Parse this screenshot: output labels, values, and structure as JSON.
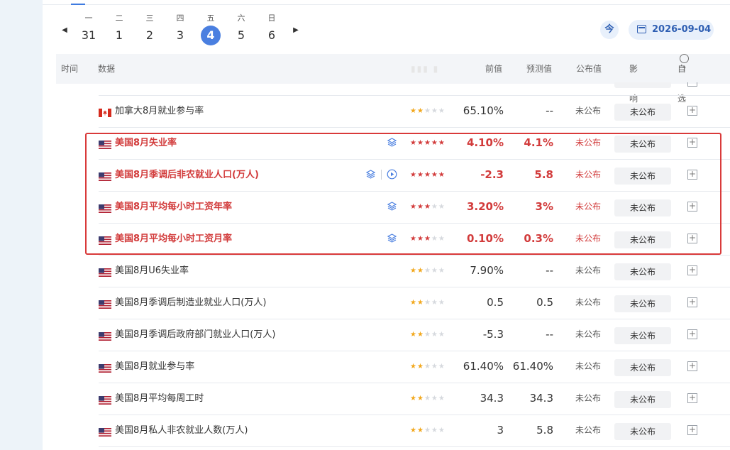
{
  "calendar": {
    "prev_arrow": "◀",
    "next_arrow": "▶",
    "days": [
      {
        "weekday": "一",
        "date": "31"
      },
      {
        "weekday": "二",
        "date": "1"
      },
      {
        "weekday": "三",
        "date": "2"
      },
      {
        "weekday": "四",
        "date": "3"
      },
      {
        "weekday": "五",
        "date": "4",
        "selected": true
      },
      {
        "weekday": "六",
        "date": "5"
      },
      {
        "weekday": "日",
        "date": "6"
      }
    ],
    "today_button": "今",
    "selected_date": "2026-09-04"
  },
  "table": {
    "headers": {
      "time": "时间",
      "data": "数据",
      "previous": "前值",
      "forecast": "预测值",
      "actual": "公布值",
      "impact": "影响",
      "watchlist": "自选"
    },
    "rows": [
      {
        "country": "CA",
        "name": "加拿大8月就业参与率",
        "stars": 2,
        "previous": "65.10%",
        "forecast": "--",
        "actual": "未公布",
        "impact": "未公布",
        "highlight": false
      },
      {
        "country": "US",
        "name": "美国8月失业率",
        "stars": 5,
        "previous": "4.10%",
        "forecast": "4.1%",
        "actual": "未公布",
        "impact": "未公布",
        "highlight": true,
        "icons": [
          "layers-icon"
        ]
      },
      {
        "country": "US",
        "name": "美国8月季调后非农就业人口(万人)",
        "stars": 5,
        "previous": "-2.3",
        "forecast": "5.8",
        "actual": "未公布",
        "impact": "未公布",
        "highlight": true,
        "icons": [
          "layers-icon",
          "play-icon"
        ]
      },
      {
        "country": "US",
        "name": "美国8月平均每小时工资年率",
        "stars": 3,
        "previous": "3.20%",
        "forecast": "3%",
        "actual": "未公布",
        "impact": "未公布",
        "highlight": true,
        "icons": [
          "layers-icon"
        ]
      },
      {
        "country": "US",
        "name": "美国8月平均每小时工资月率",
        "stars": 3,
        "previous": "0.10%",
        "forecast": "0.3%",
        "actual": "未公布",
        "impact": "未公布",
        "highlight": true,
        "icons": [
          "layers-icon"
        ]
      },
      {
        "country": "US",
        "name": "美国8月U6失业率",
        "stars": 2,
        "previous": "7.90%",
        "forecast": "--",
        "actual": "未公布",
        "impact": "未公布",
        "highlight": false
      },
      {
        "country": "US",
        "name": "美国8月季调后制造业就业人口(万人)",
        "stars": 2,
        "previous": "0.5",
        "forecast": "0.5",
        "actual": "未公布",
        "impact": "未公布",
        "highlight": false
      },
      {
        "country": "US",
        "name": "美国8月季调后政府部门就业人口(万人)",
        "stars": 2,
        "previous": "-5.3",
        "forecast": "--",
        "actual": "未公布",
        "impact": "未公布",
        "highlight": false
      },
      {
        "country": "US",
        "name": "美国8月就业参与率",
        "stars": 2,
        "previous": "61.40%",
        "forecast": "61.40%",
        "actual": "未公布",
        "impact": "未公布",
        "highlight": false
      },
      {
        "country": "US",
        "name": "美国8月平均每周工时",
        "stars": 2,
        "previous": "34.3",
        "forecast": "34.3",
        "actual": "未公布",
        "impact": "未公布",
        "highlight": false
      },
      {
        "country": "US",
        "name": "美国8月私人非农就业人数(万人)",
        "stars": 2,
        "previous": "3",
        "forecast": "5.8",
        "actual": "未公布",
        "impact": "未公布",
        "highlight": false
      }
    ]
  },
  "colors": {
    "accent": "#4a7fe0",
    "highlight_red": "#d23b3b",
    "star_gold": "#f2a81d",
    "box_red": "#d93a3a"
  }
}
